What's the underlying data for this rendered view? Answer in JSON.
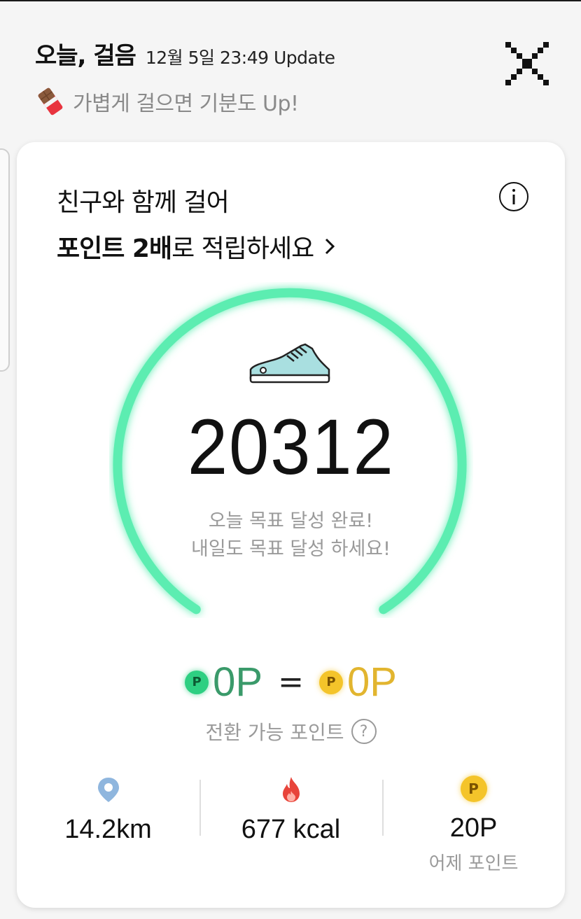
{
  "header": {
    "title": "오늘, 걸음",
    "update": "12월 5일 23:49 Update",
    "subtitle": "가볍게 걸으면 기분도 Up!"
  },
  "promo": {
    "line1": "친구와 함께 걸어",
    "line2_bold": "포인트 2배",
    "line2_rest": "로 적립하세요"
  },
  "steps": {
    "count": "20312",
    "goal_line1": "오늘 목표 달성 완료!",
    "goal_line2": "내일도 목표 달성 하세요!"
  },
  "points": {
    "coin_label": "P",
    "earned": "0P",
    "equals": "=",
    "converted": "0P",
    "convertible_label": "전환 가능 포인트",
    "help_label": "?"
  },
  "stats": [
    {
      "icon": "location-pin-icon",
      "value": "14.2km",
      "caption": ""
    },
    {
      "icon": "flame-icon",
      "value": "677 kcal",
      "caption": ""
    },
    {
      "icon": "point-coin-icon",
      "value": "20P",
      "caption": "어제 포인트"
    }
  ],
  "colors": {
    "ring": "#5bedb1",
    "green_point": "#3a9a6a",
    "gold_point": "#e2b52f",
    "pin": "#8fb6de",
    "flame": "#e8443a"
  }
}
